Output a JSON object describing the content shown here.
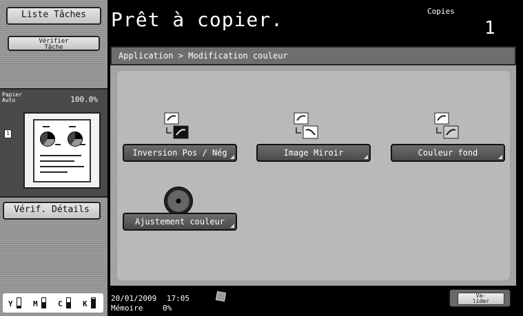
{
  "left_panel": {
    "liste_taches": "Liste Tâches",
    "verifier_tache_line1": "Vérifier",
    "verifier_tache_line2": "Tâche",
    "paper_line1": "Papier",
    "paper_line2": "Auto",
    "zoom": "100.0%",
    "page_icon": "1",
    "verif_details": "Vérif. Détails",
    "toner": [
      {
        "letter": "Y",
        "level": 0.25
      },
      {
        "letter": "M",
        "level": 0.55
      },
      {
        "letter": "C",
        "level": 0.55
      },
      {
        "letter": "K",
        "level": 0.9
      }
    ]
  },
  "header": {
    "title": "Prêt à copier.",
    "copies_label": "Copies",
    "copies_value": "1"
  },
  "main": {
    "breadcrumb": "Application > Modification couleur",
    "buttons": [
      {
        "label": "Inversion Pos / Nég",
        "icon": "banana-negative-icon"
      },
      {
        "label": "Image Miroir",
        "icon": "banana-mirror-icon"
      },
      {
        "label": "Couleur fond",
        "icon": "banana-background-icon"
      },
      {
        "label": "Ajustement couleur",
        "icon": "color-wheel-icon"
      }
    ]
  },
  "footer": {
    "date": "20/01/2009",
    "time": "17:05",
    "memory_label": "Mémoire",
    "memory_value": "0%",
    "valider_line1": "Va-",
    "valider_line2": "lider"
  }
}
